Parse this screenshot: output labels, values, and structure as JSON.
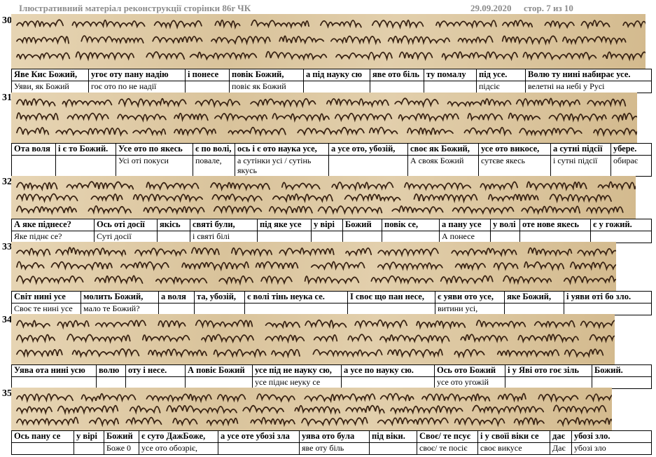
{
  "header": {
    "title": "Ілюстративний матеріал  реконструкції сторінки 86r ЧК",
    "date": "29.09.2020",
    "page": "стор. 7 из 10"
  },
  "blocks": [
    {
      "num": "30",
      "top": [
        "Яве Кис Божий,",
        "угоє оту пану надію",
        "і понесе",
        "повік Божий,",
        "а під науку сю",
        "яве ото біль",
        "ту помалу",
        "під усе.",
        "Волю ту нині набирає усе."
      ],
      "bottom": [
        "Уяви, як Божий",
        "гоє ото по не надії",
        "",
        "повіє як Божий",
        "",
        "",
        "",
        "підсіє",
        "велетні на небі у Русі"
      ]
    },
    {
      "num": "31",
      "top": [
        "Ота воля",
        "і є то Божий.",
        "Усе ото по якесь",
        "є по волі,",
        "ось і є ото наука усе,",
        "а усе ото, убозій,",
        "своє як Божий,",
        "усе ото викосе,",
        "а сутні підсії",
        "убере."
      ],
      "bottom": [
        "",
        "",
        "Усі оті покуси",
        "повале,",
        "а сутінки усі / сутінь якусь",
        "",
        "А свояк Божий",
        "сутєве якесь",
        "і сутні підсії",
        "обирає"
      ]
    },
    {
      "num": "32",
      "top": [
        "А яке піднесе?",
        "Ось оті досії",
        "якісь",
        "святі були,",
        "під яке усе",
        "у вірі",
        "Божий",
        "повік се,",
        "а пану усе",
        "у волі",
        "оте нове якесь",
        "є у гожий."
      ],
      "bottom": [
        "Яке піднє се?",
        "Суті досії",
        "",
        "і святі білі",
        "",
        "",
        "",
        "",
        "А понесе",
        "",
        "",
        ""
      ]
    },
    {
      "num": "33",
      "top": [
        "Світ нині усе",
        "молить Божий,",
        "а воля",
        "та, убозій,",
        "є волі тінь неука се.",
        "І своє що пан несе,",
        "є уяви ото усе,",
        "яке Божий,",
        "і уяви оті бо зло."
      ],
      "bottom": [
        "Своє те нині усе",
        "мало те Божий?",
        "",
        "",
        "",
        "",
        "витини усі,",
        "",
        ""
      ]
    },
    {
      "num": "34",
      "top": [
        "Уява ота нині усю",
        "волю",
        "оту і несе.",
        "А повіє Божий",
        "усе під не науку сю,",
        "а усе по науку сю.",
        "Ось ото Божий",
        "і у Яві ото гоє зіль",
        "Божий."
      ],
      "bottom": [
        "",
        "",
        "",
        "",
        "усе піднє неуку се",
        "",
        "усе ото угожій",
        "",
        ""
      ]
    },
    {
      "num": "35",
      "top": [
        "Ось пану се",
        "у вірі",
        "Божий",
        "є суто ДажБоже,",
        "а усе оте убозі зла",
        "уява ото була",
        "під віки.",
        "Своє/ те псує",
        "і у своїі віки се",
        "дає",
        "убозі зло."
      ],
      "bottom": [
        "",
        "",
        "Боже 0",
        "усе ото обозріє,",
        "",
        "яве оту біль",
        "",
        "своє/ те посіє",
        "своє викусе",
        "Дає",
        "убозі зло"
      ]
    }
  ]
}
